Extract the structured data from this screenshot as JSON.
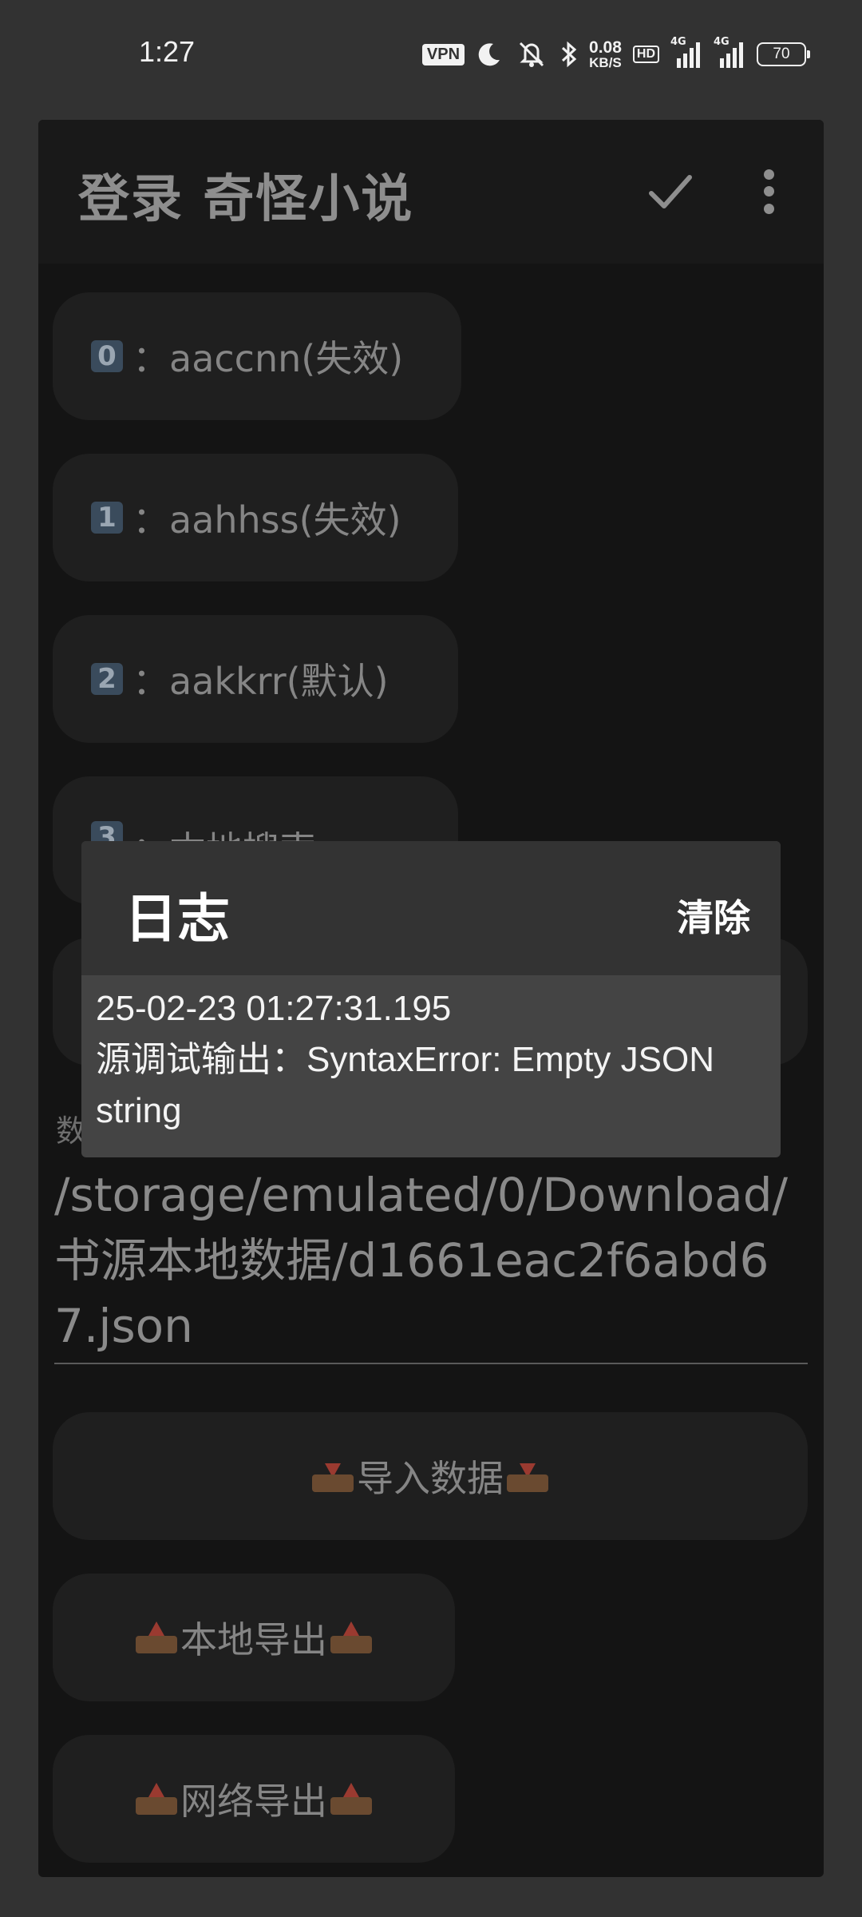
{
  "status_bar": {
    "time": "1:27",
    "vpn": "VPN",
    "net_speed_value": "0.08",
    "net_speed_unit": "KB/S",
    "hd": "HD",
    "signal1_label": "4G",
    "signal2_label": "4G",
    "battery": "70"
  },
  "appbar": {
    "title": "登录 奇怪小说"
  },
  "accounts": [
    {
      "index": "0",
      "label": "：aaccnn(失效)"
    },
    {
      "index": "1",
      "label": "：aahhss(失效)"
    },
    {
      "index": "2",
      "label": "：aakkrr(默认)"
    },
    {
      "index": "3",
      "label": "：本地搜索"
    }
  ],
  "data_field": {
    "label": "数",
    "value": "/storage/emulated/0/Download/书源本地数据/d1661eac2f6abd67.json"
  },
  "buttons": {
    "import": "导入数据",
    "local_export": "本地导出",
    "network_export": "网络导出"
  },
  "dialog": {
    "title": "日志",
    "clear": "清除",
    "timestamp": "25-02-23 01:27:31.195",
    "message": "源调试输出：SyntaxError: Empty JSON string"
  }
}
